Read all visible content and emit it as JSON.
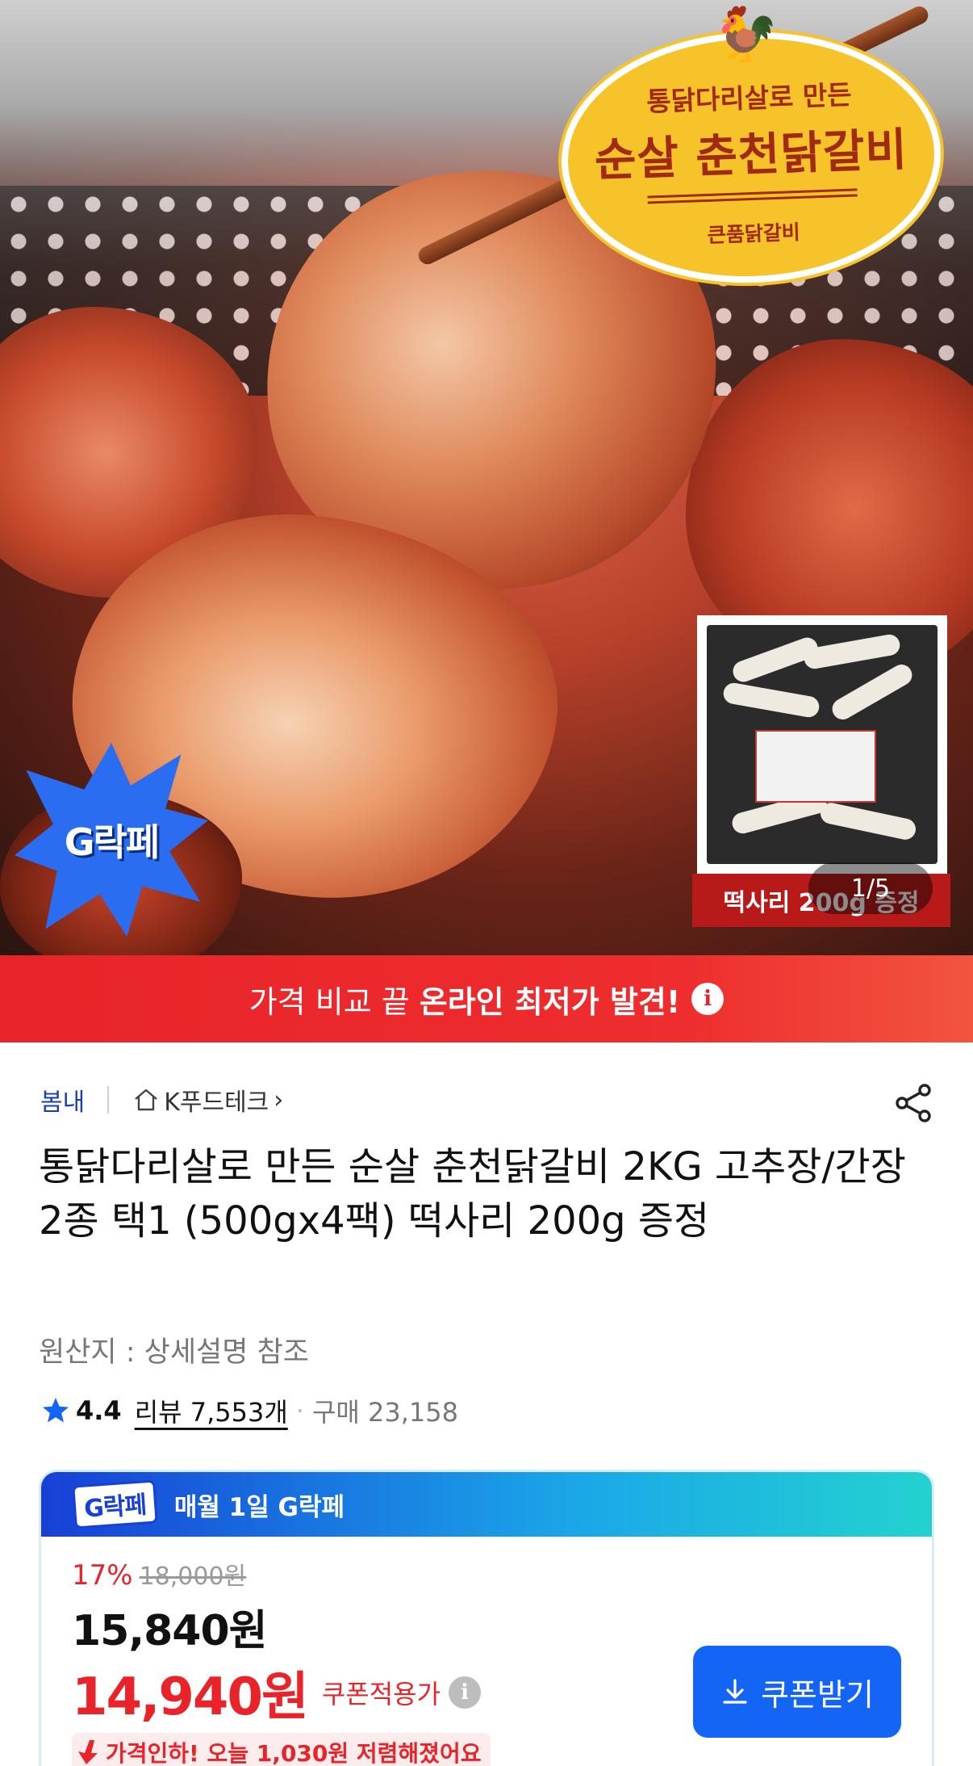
{
  "hero": {
    "badge_line1": "통닭다리살로 만든",
    "badge_line2": "순살 춘천닭갈비",
    "badge_line3": "큰품닭갈비",
    "promo_logo": "G락페",
    "inset_caption": "떡사리 200g 증정",
    "pager": "1/5"
  },
  "banner": {
    "text": "가격 비교 끝",
    "strong": "온라인 최저가 발견!",
    "info_icon": "i"
  },
  "product": {
    "brand": "봄내",
    "store": "K푸드테크",
    "store_chevron": "›",
    "title": "통닭다리살로 만든 순살 춘천닭갈비 2KG 고추장/간장 2종 택1 (500gx4팩) 떡사리 200g 증정",
    "origin": "원산지 : 상세설명 참조",
    "rating": "4.4",
    "review_label": "리뷰 7,553개",
    "dot": "·",
    "purchase_label": "구매 23,158"
  },
  "price": {
    "promo_logo": "G락페",
    "promo_title": "매월 1일 G락페",
    "discount_pct": "17%",
    "original": "18,000원",
    "sale": "15,840원",
    "coupon_price": "14,940원",
    "coupon_label": "쿠폰적용가",
    "coupon_info_icon": "i",
    "drop_note": "가격인하! 오늘 1,030원 저렴해졌어요",
    "coupon_button": "쿠폰받기"
  },
  "icons": {
    "home": "home-icon",
    "share": "share-icon",
    "star": "star-icon",
    "download": "download-icon",
    "price_drop": "arrow-down-icon"
  },
  "colors": {
    "brand_blue": "#1b3fa8",
    "sale_red": "#e8242a",
    "coupon_button": "#1465f5"
  }
}
